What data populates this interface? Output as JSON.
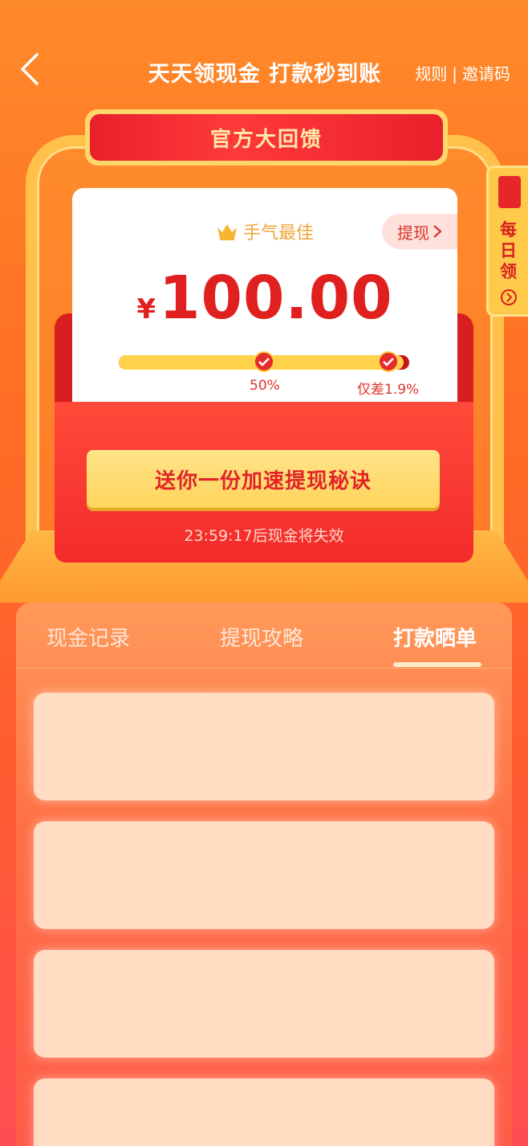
{
  "header": {
    "title": "天天领现金 打款秒到账",
    "rules_label": "规则",
    "separator": "|",
    "invite_label": "邀请码"
  },
  "ribbon": {
    "label": "官方大回馈"
  },
  "card": {
    "best_luck_label": "手气最佳",
    "withdraw_label": "提现",
    "currency_symbol": "¥",
    "amount": "100.00",
    "progress": {
      "value_fraction": 0.98,
      "checkpoint1_label": "50%",
      "checkpoint2_label": "仅差1.9%"
    }
  },
  "envelope": {
    "cta_label": "送你一份加速提现秘诀",
    "expire_text": "23:59:17后现金将失效"
  },
  "daily_tab": {
    "label_chars": [
      "每",
      "日",
      "领"
    ]
  },
  "panel": {
    "tabs": [
      {
        "label": "现金记录",
        "active": false
      },
      {
        "label": "提现攻略",
        "active": false
      },
      {
        "label": "打款晒单",
        "active": true
      }
    ],
    "record_count": 4
  },
  "colors": {
    "accent_red": "#e01f1f",
    "gold": "#ffd24a",
    "background_orange": "#ff7a28"
  }
}
